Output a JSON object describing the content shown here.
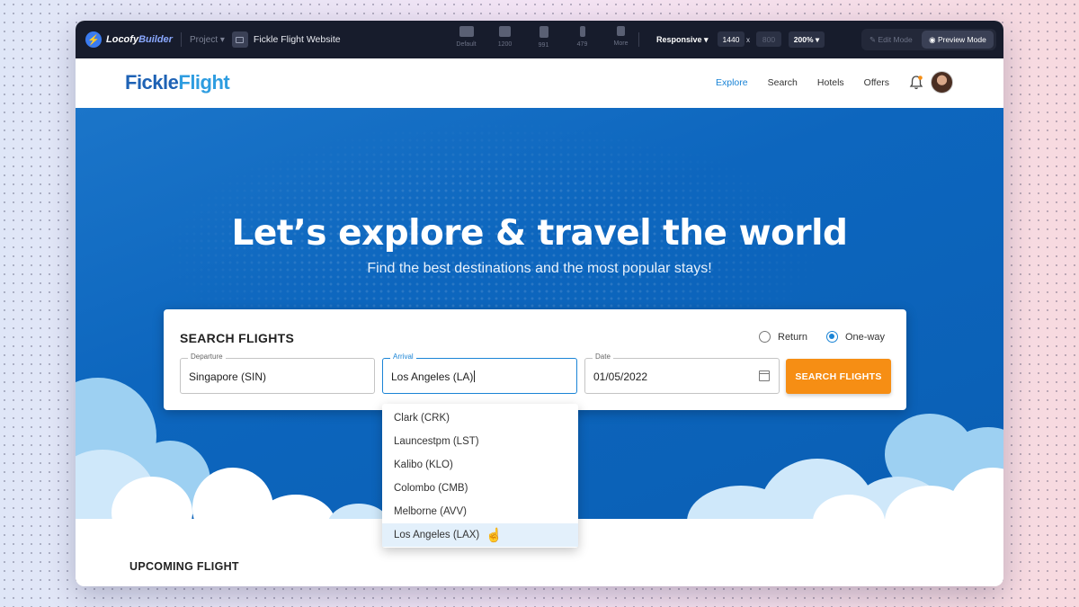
{
  "builder": {
    "logo": "Locofy",
    "logo_suffix": "Builder",
    "project_label": "Project",
    "project_name": "Fickle Flight Website",
    "devices": [
      {
        "icon": "desktop-icon",
        "label": "Default"
      },
      {
        "icon": "laptop-icon",
        "label": "1200"
      },
      {
        "icon": "tablet-icon",
        "label": "991"
      },
      {
        "icon": "phone-icon",
        "label": "479"
      },
      {
        "icon": "more-icon",
        "label": "More"
      }
    ],
    "responsive": "Responsive",
    "width": "1440",
    "height_placeholder": "800",
    "zoom": "200%",
    "edit_mode": "Edit Mode",
    "preview_mode": "Preview Mode"
  },
  "site": {
    "brand_a": "Fickle",
    "brand_b": "Flight",
    "nav": [
      "Explore",
      "Search",
      "Hotels",
      "Offers"
    ],
    "hero_title": "Let’s explore & travel the world",
    "hero_subtitle": "Find the best destinations and the most popular stays!",
    "search": {
      "title": "SEARCH FLIGHTS",
      "return_label": "Return",
      "oneway_label": "One-way",
      "trip_type": "One-way",
      "departure_label": "Departure",
      "departure_value": "Singapore (SIN)",
      "arrival_label": "Arrival",
      "arrival_value": "Los Angeles (LA)",
      "date_label": "Date",
      "date_value": "01/05/2022",
      "button": "SEARCH FLIGHTS"
    },
    "arrival_options": [
      "Clark (CRK)",
      "Launcestpm (LST)",
      "Kalibo (KLO)",
      "Colombo (CMB)",
      "Melborne (AVV)",
      "Los Angeles (LAX)"
    ],
    "highlighted_option": "Los Angeles (LAX)",
    "upcoming": "UPCOMING FLIGHT"
  },
  "colors": {
    "hero": "#0d66be",
    "accent_orange": "#f68e14",
    "link_blue": "#1a84d6",
    "toolbar": "#171c2c"
  }
}
